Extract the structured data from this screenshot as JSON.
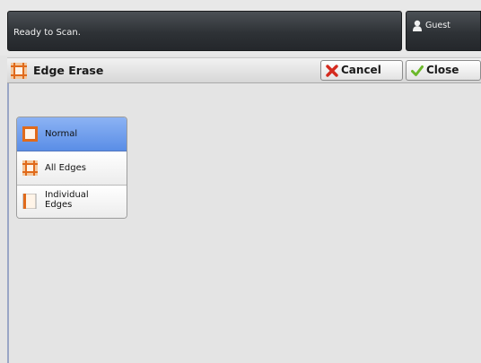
{
  "status": {
    "message": "Ready to Scan."
  },
  "user": {
    "name": "Guest",
    "icon": "user-icon"
  },
  "title_bar": {
    "title": "Edge Erase",
    "icon": "edge-erase-icon",
    "cancel_label": "Cancel",
    "close_label": "Close"
  },
  "options": {
    "items": [
      {
        "label": "Normal",
        "icon": "normal-frame-icon",
        "selected": true
      },
      {
        "label": "All Edges",
        "icon": "all-edges-icon",
        "selected": false
      },
      {
        "label": "Individual Edges",
        "line1": "Individual",
        "line2": "Edges",
        "icon": "individual-edges-icon",
        "selected": false
      }
    ]
  },
  "colors": {
    "accent_selected": "#5a8ee6",
    "icon_orange": "#e06a1b",
    "cancel_red": "#d42a1e",
    "close_green": "#6bb82a"
  }
}
